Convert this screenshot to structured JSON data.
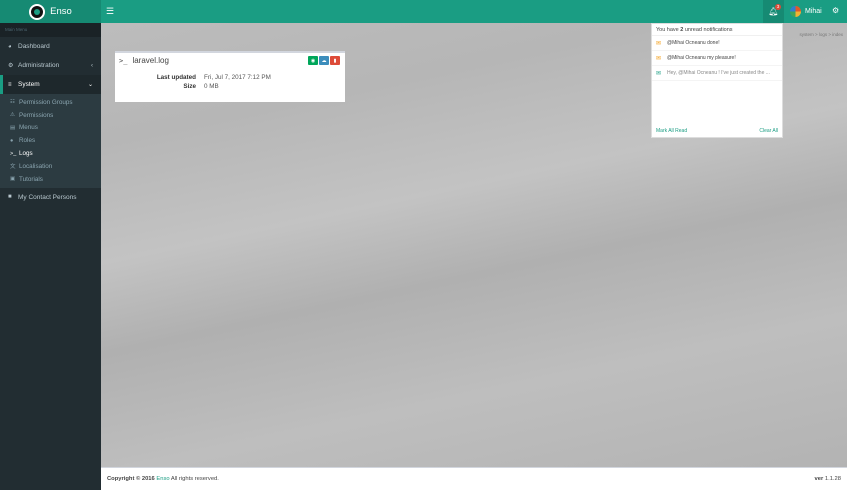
{
  "header": {
    "brand": "Enso",
    "hamburger_icon": "☰",
    "notification_count": "3",
    "user_name": "Mihai"
  },
  "sidebar": {
    "header": "Main Menu",
    "items": [
      {
        "icon": "dashboard-icon",
        "label": "Dashboard"
      },
      {
        "icon": "cogs-icon",
        "label": "Administration"
      },
      {
        "icon": "sliders-icon",
        "label": "System"
      }
    ],
    "system_submenu": [
      {
        "icon": "list-icon",
        "label": "Permission Groups"
      },
      {
        "icon": "warning-icon",
        "label": "Permissions"
      },
      {
        "icon": "list-alt-icon",
        "label": "Menus"
      },
      {
        "icon": "user-secret-icon",
        "label": "Roles"
      },
      {
        "icon": "terminal-icon",
        "label": "Logs"
      },
      {
        "icon": "language-icon",
        "label": "Localisation"
      },
      {
        "icon": "book-icon",
        "label": "Tutorials"
      }
    ],
    "contact": {
      "icon": "address-book-icon",
      "label": "My Contact Persons"
    }
  },
  "breadcrumb": "system  >  logs  >  index",
  "log_box": {
    "title": "laravel.log",
    "rows": [
      {
        "label": "Last updated",
        "value": "Fri, Jul 7, 2017 7:12 PM"
      },
      {
        "label": "Size",
        "value": "0 MB"
      }
    ]
  },
  "notifications": {
    "header_prefix": "You have ",
    "count": "2",
    "header_suffix": " unread notifications",
    "items": [
      {
        "icon": "envelope-icon",
        "text": "@Mihai Ocneanu done!",
        "read": false
      },
      {
        "icon": "envelope-icon",
        "text": "@Mihai Ocneanu my pleasure!",
        "read": false
      },
      {
        "icon": "envelope-open-icon",
        "text": "Hey, @Mihai Ocneanu ! I've just created the ...",
        "read": true
      }
    ],
    "mark_all_read": "Mark All Read",
    "clear_all": "Clear All"
  },
  "footer": {
    "copyright_prefix": "Copyright © 2016 ",
    "brand": "Enso",
    "copyright_suffix": " All rights reserved.",
    "version_label": "ver",
    "version": "1.1.28"
  },
  "colors": {
    "accent": "#1a9d83",
    "sidebar_bg": "#222d32",
    "success": "#00a65a",
    "info": "#3c8dbc",
    "danger": "#dd4b39",
    "warning": "#f39c12"
  }
}
